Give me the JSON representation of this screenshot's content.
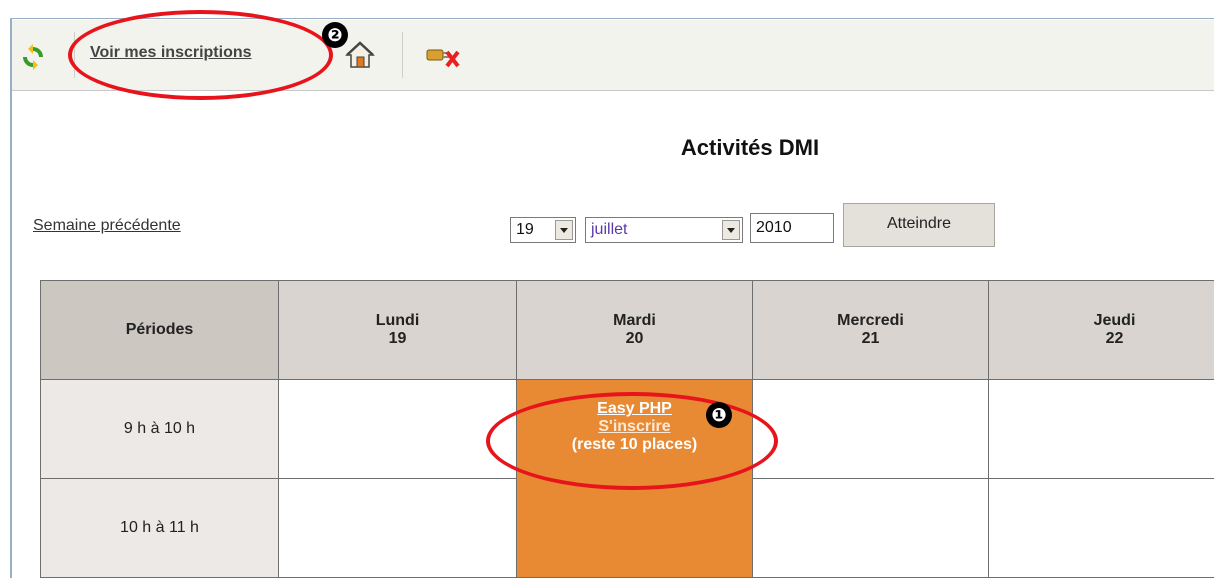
{
  "toolbar": {
    "refresh_icon": "refresh-icon",
    "inscriptions_link": "Voir mes inscriptions",
    "home_icon": "home-icon",
    "logout_icon": "logout-icon"
  },
  "markers": {
    "one": "❶",
    "two": "❷"
  },
  "page_title": "Activités DMI",
  "navigation": {
    "previous_week": "Semaine précédente",
    "day_value": "19",
    "month_value": "juillet",
    "year_value": "2010",
    "go_button": "Atteindre"
  },
  "calendar": {
    "periods_header": "Périodes",
    "days": [
      {
        "name": "Lundi",
        "date": "19"
      },
      {
        "name": "Mardi",
        "date": "20"
      },
      {
        "name": "Mercredi",
        "date": "21"
      },
      {
        "name": "Jeudi",
        "date": "22"
      }
    ],
    "periods": [
      {
        "label": "9 h  à 10 h"
      },
      {
        "label": "10 h  à 11 h"
      }
    ],
    "activity": {
      "name": "Easy PHP",
      "action": "S'inscrire",
      "remaining": "(reste 10 places)"
    }
  },
  "colors": {
    "accent_orange": "#e88a34",
    "highlight_red": "#e8141c",
    "header_bg": "#d9d4cf"
  }
}
